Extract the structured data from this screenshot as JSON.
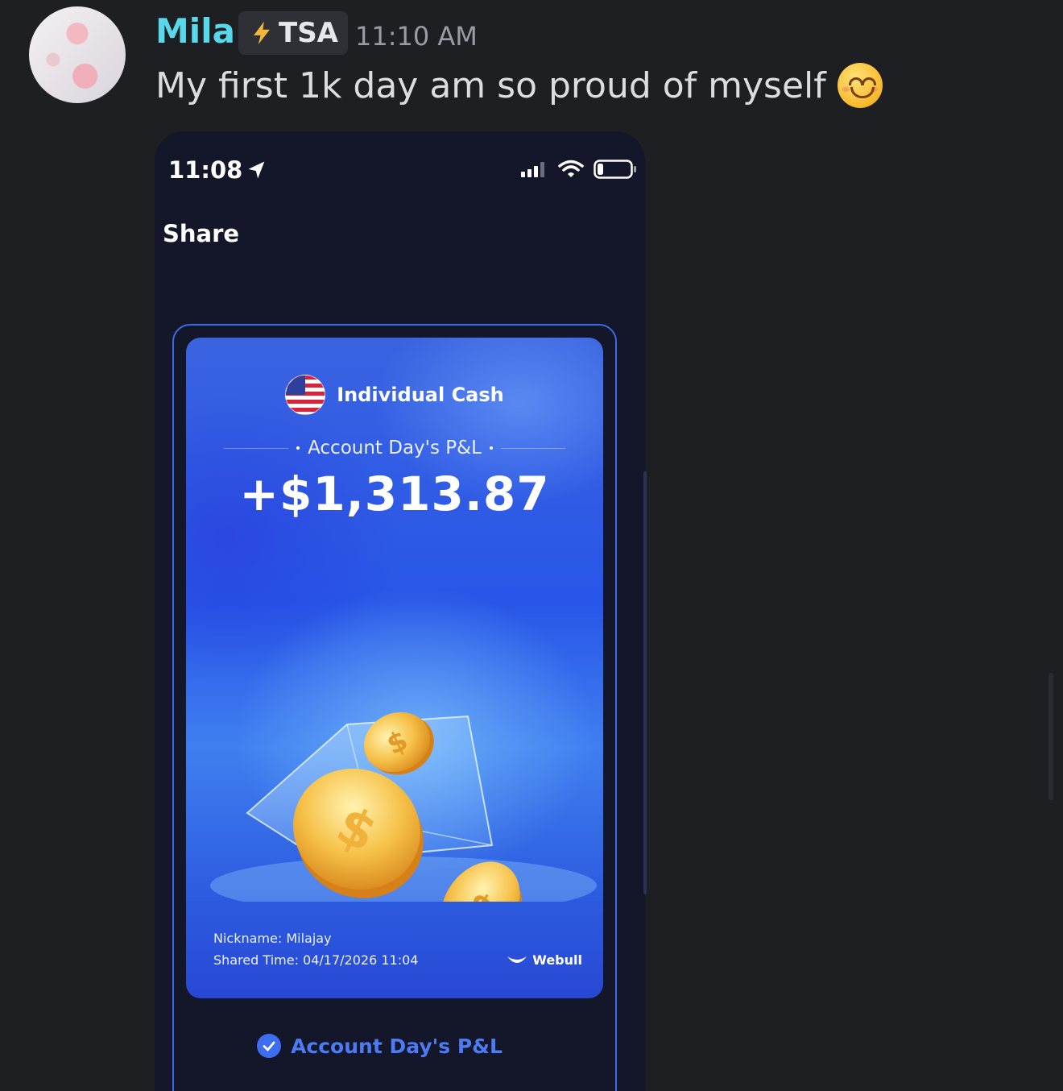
{
  "message": {
    "username": "Mila",
    "tag": "TSA",
    "timestamp": "11:10 AM",
    "text": "My first 1k day am so proud of myself"
  },
  "screenshot": {
    "status_time": "11:08",
    "page_title": "Share",
    "card": {
      "account": "Individual Cash",
      "pl_label": "Account Day's P&L",
      "pl_value": "+$1,313.87",
      "nickname": "Nickname: Milajay",
      "shared_time": "Shared Time: 04/17/2026 11:04",
      "brand": "Webull"
    },
    "option_label": "Account Day's P&L"
  },
  "colors": {
    "username": "#58d8e8",
    "background": "#1e1f23",
    "accent_blue": "#3e6df2"
  }
}
